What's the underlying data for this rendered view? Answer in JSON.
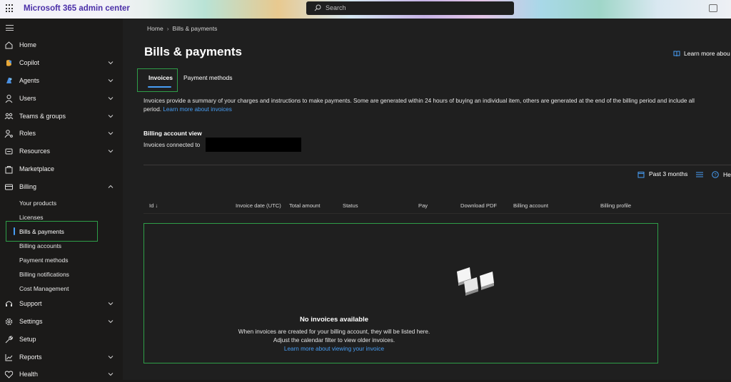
{
  "header": {
    "app_title": "Microsoft 365 admin center",
    "search_placeholder": "Search"
  },
  "sidebar": {
    "items": [
      {
        "label": "Home"
      },
      {
        "label": "Copilot"
      },
      {
        "label": "Agents"
      },
      {
        "label": "Users"
      },
      {
        "label": "Teams & groups"
      },
      {
        "label": "Roles"
      },
      {
        "label": "Resources"
      },
      {
        "label": "Marketplace"
      },
      {
        "label": "Billing"
      },
      {
        "label": "Support"
      },
      {
        "label": "Settings"
      },
      {
        "label": "Setup"
      },
      {
        "label": "Reports"
      },
      {
        "label": "Health"
      }
    ],
    "billing_sub": [
      {
        "label": "Your products"
      },
      {
        "label": "Licenses"
      },
      {
        "label": "Bills & payments"
      },
      {
        "label": "Billing accounts"
      },
      {
        "label": "Payment methods"
      },
      {
        "label": "Billing notifications"
      },
      {
        "label": "Cost Management"
      }
    ]
  },
  "breadcrumb": {
    "home": "Home",
    "current": "Bills & payments"
  },
  "page": {
    "title": "Bills & payments",
    "learn_more": "Learn more abou",
    "tabs": [
      {
        "label": "Invoices",
        "selected": true
      },
      {
        "label": "Payment methods",
        "selected": false
      }
    ],
    "description_line1": "Invoices provide a summary of your charges and instructions to make payments. Some are generated within 24 hours of buying an individual item, others are generated at the end of the billing period and include all",
    "description_line2": "period.",
    "description_link": "Learn more about invoices",
    "billing_view_title": "Billing account view",
    "billing_view_text": "Invoices connected to"
  },
  "toolbar": {
    "date_filter": "Past 3 months",
    "help_label": "He"
  },
  "table": {
    "columns": [
      "Id ↓",
      "Invoice date (UTC)",
      "Total amount",
      "Status",
      "Pay",
      "Download PDF",
      "Billing account",
      "Billing profile"
    ]
  },
  "empty_state": {
    "title": "No invoices available",
    "line1": "When invoices are created for your billing account, they will be listed here.",
    "line2": "Adjust the calendar filter to view older invoices.",
    "link": "Learn more about viewing your invoice"
  },
  "colors": {
    "accent": "#479ef5",
    "highlight": "#2e9e48",
    "brand_title": "#4b2fa8"
  }
}
